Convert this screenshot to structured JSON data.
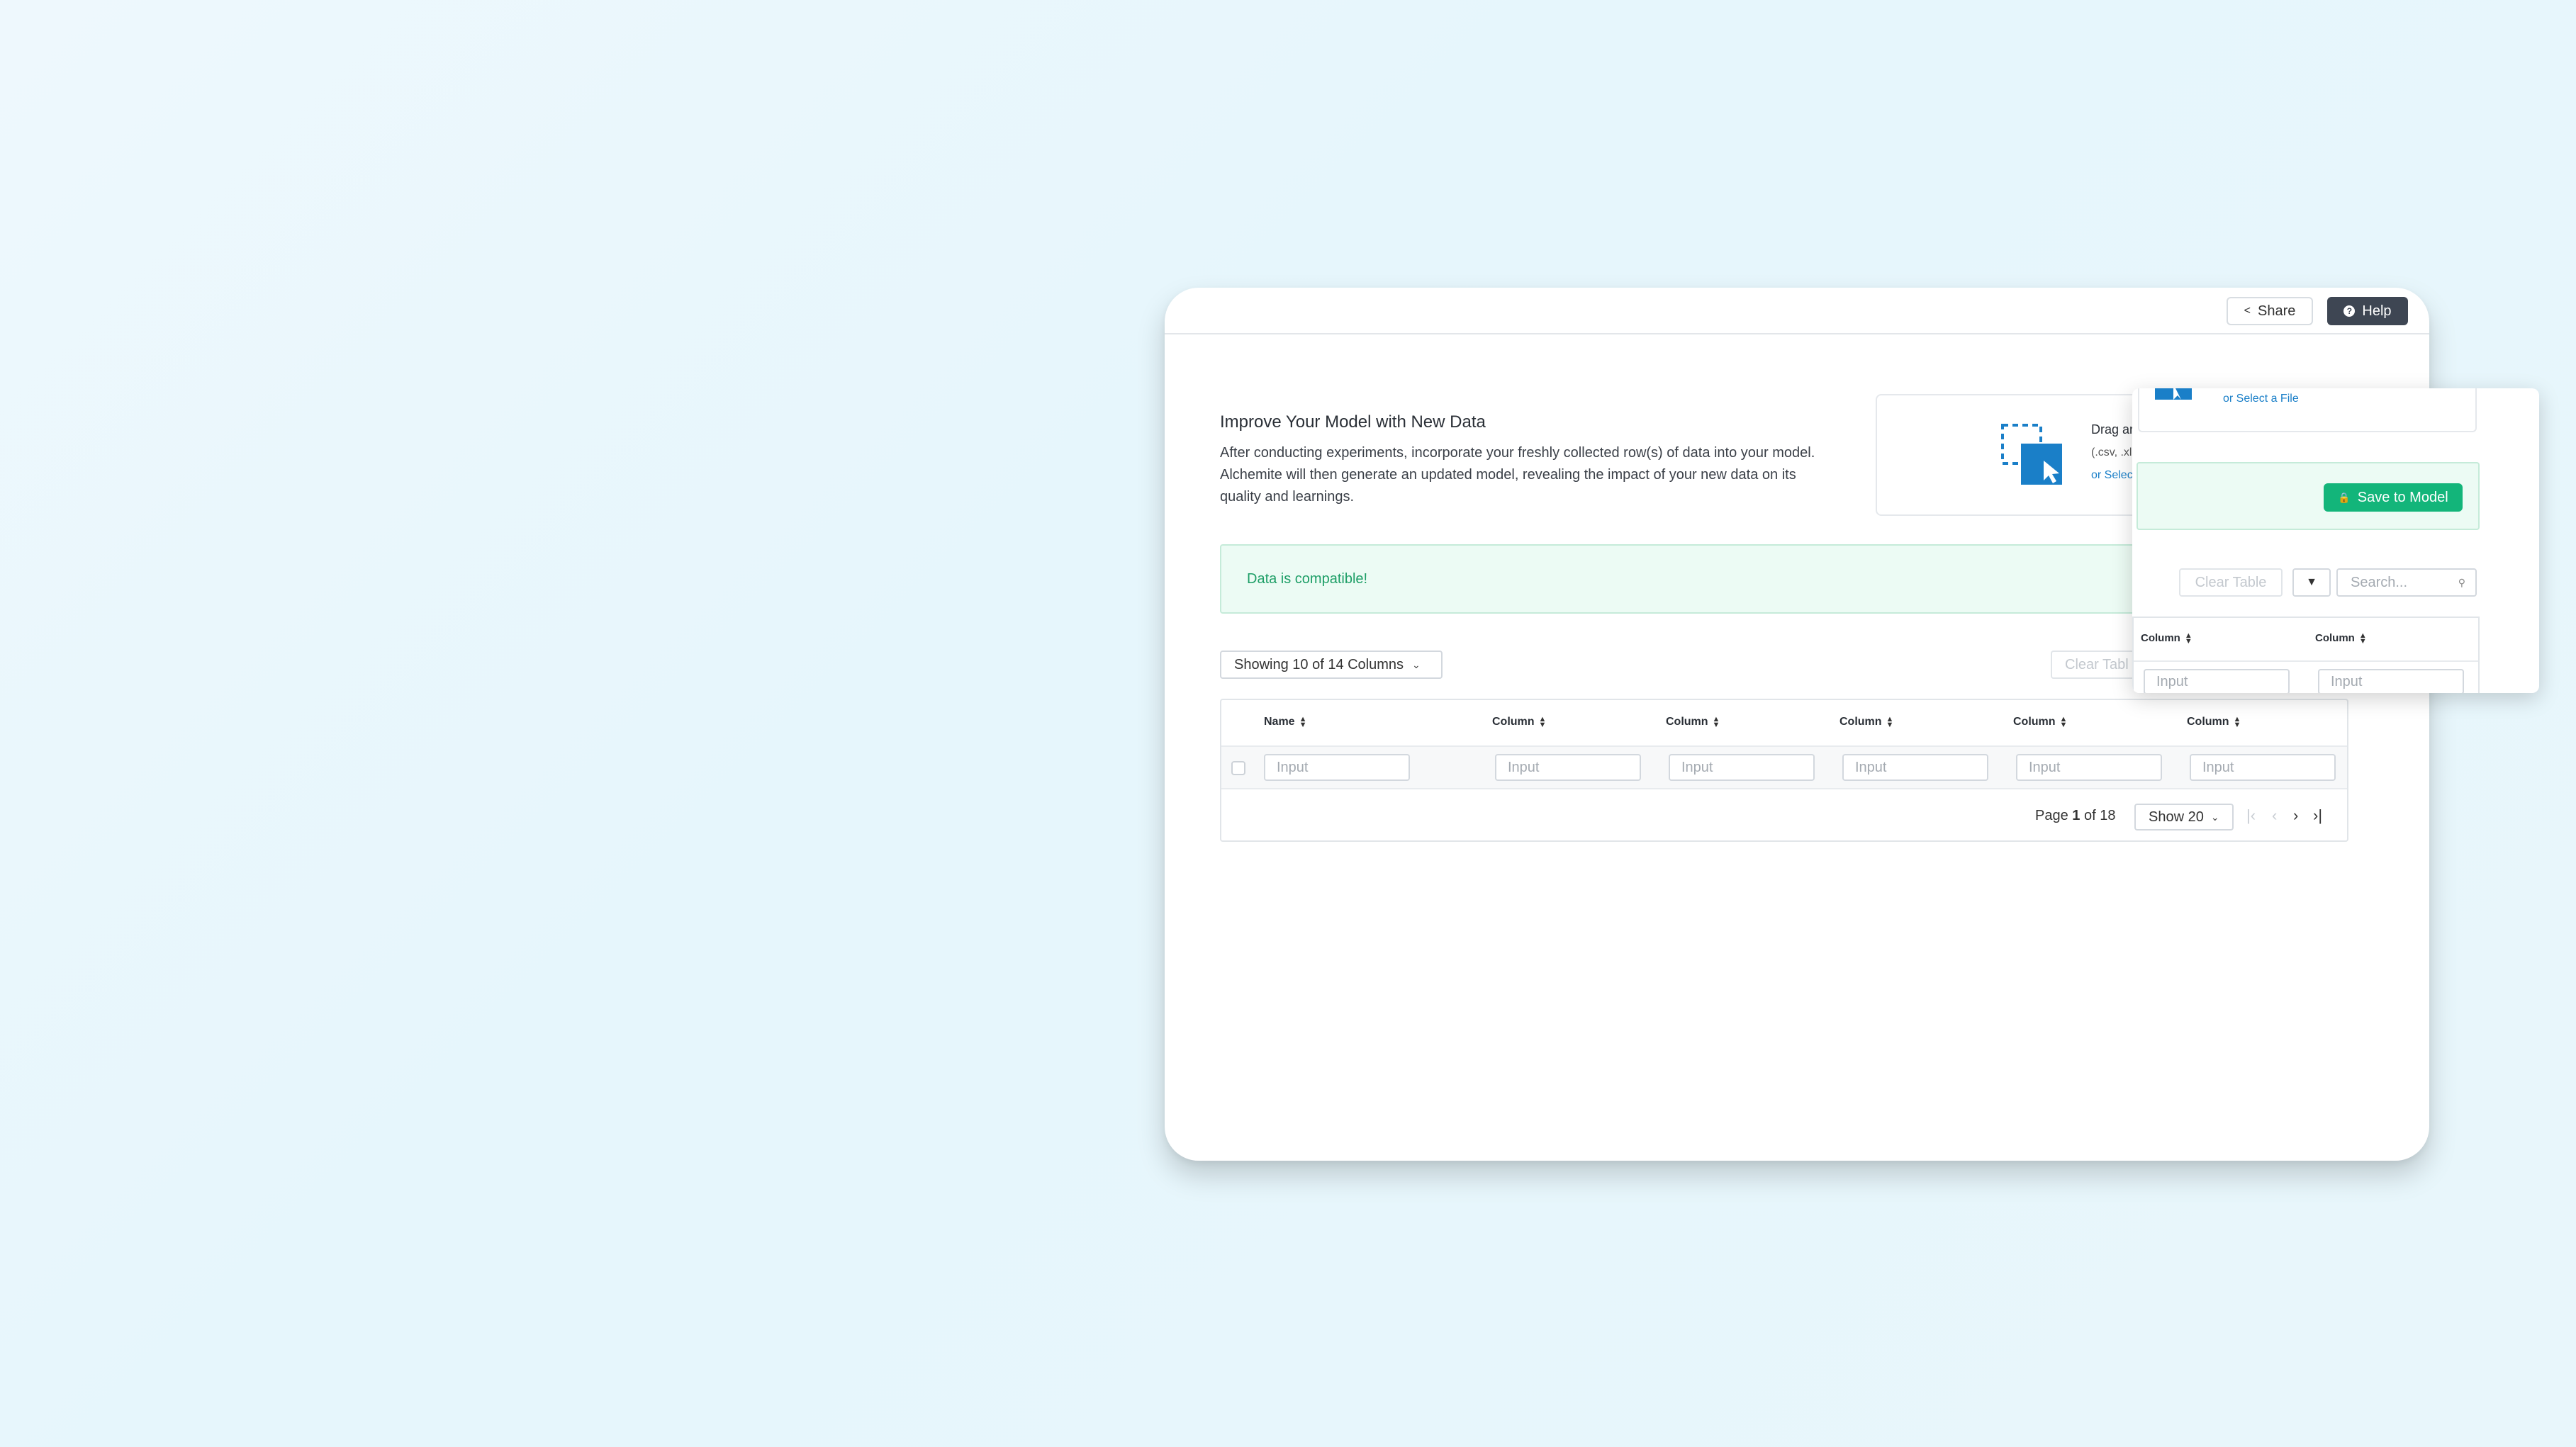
{
  "header": {
    "share_label": "Share",
    "help_label": "Help"
  },
  "intro": {
    "title": "Improve Your Model with New Data",
    "description": "After conducting experiments, incorporate your freshly collected row(s) of data into your model. Alchemite will then generate an updated model, revealing the impact of your new data on its quality and learnings."
  },
  "upload": {
    "drag_text": "Drag ar",
    "formats_text": "(.csv, .xl",
    "select_link": "or Selec"
  },
  "alert": {
    "text": "Data is compatible!"
  },
  "toolbar": {
    "columns_select": "Showing 10 of 14 Columns",
    "clear_table_partial": "Clear Tabl"
  },
  "table": {
    "headers": [
      "Name",
      "Column",
      "Column",
      "Column",
      "Column",
      "Column"
    ],
    "row_inputs": [
      "Input",
      "Input",
      "Input",
      "Input",
      "Input",
      "Input"
    ]
  },
  "pagination": {
    "page_prefix": "Page",
    "current_page": "1",
    "of_text": "of 18",
    "show_select": "Show 20"
  },
  "overlay": {
    "select_link": "or Select a File",
    "save_button": "Save to Model",
    "clear_table": "Clear Table",
    "search_placeholder": "Search...",
    "headers": [
      "Column",
      "Column"
    ],
    "row_inputs": [
      "Input",
      "Input"
    ]
  },
  "colors": {
    "accent_blue": "#1a7fc8",
    "success_green": "#13b57a",
    "help_button": "#3e4653"
  }
}
